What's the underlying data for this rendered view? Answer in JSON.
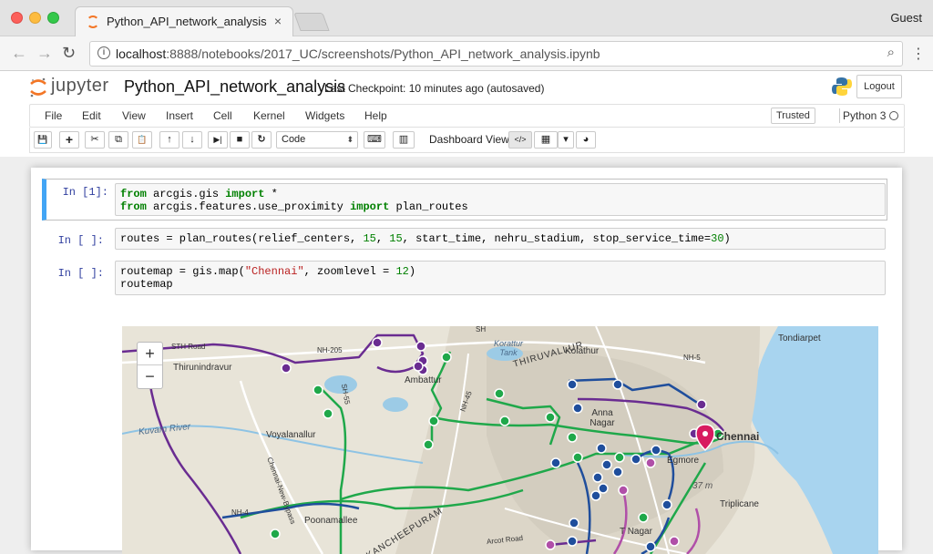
{
  "browser": {
    "tab_title": "Python_API_network_analysis",
    "tab_close": "×",
    "user": "Guest",
    "url_host": "localhost",
    "url_rest": ":8888/notebooks/2017_UC/screenshots/Python_API_network_analysis.ipynb",
    "back_icon": "←",
    "forward_icon": "→",
    "reload_icon": "↻",
    "zoom_icon": "⌕",
    "menu_icon": "⋮",
    "info_icon": "i"
  },
  "jupyter": {
    "logo_text": "jupyter",
    "notebook_name": "Python_API_network_analysis",
    "checkpoint": "Last Checkpoint: 10 minutes ago (autosaved)",
    "logout_label": "Logout",
    "menu": [
      "File",
      "Edit",
      "View",
      "Insert",
      "Cell",
      "Kernel",
      "Widgets",
      "Help"
    ],
    "trusted_label": "Trusted",
    "kernel_name": "Python 3",
    "cell_type": "Code",
    "dashboard_label": "Dashboard View:",
    "toolbar_icons": {
      "save": "💾",
      "add": "+",
      "cut": "✂",
      "copy": "⧉",
      "paste": "📋",
      "move_up": "↑",
      "move_down": "↓",
      "run": "▶|",
      "stop": "■",
      "restart": "↻",
      "keyboard": "⌨",
      "chart": "▥",
      "code_view": "</>",
      "grid_view": "▦",
      "dropdown": "▾",
      "gauge": "◕",
      "select_arrow": "⬍"
    }
  },
  "cells": [
    {
      "prompt": "In [1]:",
      "lines": [
        [
          {
            "t": "from",
            "k": "kw"
          },
          {
            "t": " arcgis.gis ",
            "k": ""
          },
          {
            "t": "import",
            "k": "kw"
          },
          {
            "t": " *",
            "k": ""
          }
        ],
        [
          {
            "t": "from",
            "k": "kw"
          },
          {
            "t": " arcgis.features.use_proximity ",
            "k": ""
          },
          {
            "t": "import",
            "k": "kw"
          },
          {
            "t": " plan_routes",
            "k": ""
          }
        ]
      ]
    },
    {
      "prompt": "In [ ]:",
      "lines": [
        [
          {
            "t": "routes = plan_routes(relief_centers, ",
            "k": ""
          },
          {
            "t": "15",
            "k": "num"
          },
          {
            "t": ", ",
            "k": ""
          },
          {
            "t": "15",
            "k": "num"
          },
          {
            "t": ", start_time, nehru_stadium, stop_service_time=",
            "k": ""
          },
          {
            "t": "30",
            "k": "num"
          },
          {
            "t": ")",
            "k": ""
          }
        ]
      ]
    },
    {
      "prompt": "In [ ]:",
      "lines": [
        [
          {
            "t": "routemap = gis.map(",
            "k": ""
          },
          {
            "t": "\"Chennai\"",
            "k": "str"
          },
          {
            "t": ", zoomlevel = ",
            "k": ""
          },
          {
            "t": "12",
            "k": "num"
          },
          {
            "t": ")",
            "k": ""
          }
        ],
        [
          {
            "t": "routemap",
            "k": ""
          }
        ]
      ]
    }
  ],
  "map": {
    "zoom_in": "+",
    "zoom_out": "−",
    "labels": {
      "tondiarpet": "Tondiarpet",
      "kolathur": "Kolathur",
      "thirunindravur": "Thirunindravur",
      "ambattur": "Ambattur",
      "korattur_tank": "Korattur Tank",
      "thiruvallur": "THIRUVALLUR",
      "voyalanallur": "Voyalanallur",
      "kuvam_river": "Kuvam River",
      "anna_nagar": "Anna Nagar",
      "chennai": "Chennai",
      "egmore": "Egmore",
      "triplicane": "Triplicane",
      "poonamallee": "Poonamallee",
      "kancheepuram": "KANCHEEPURAM",
      "nh205": "NH-205",
      "nh5": "NH-5",
      "nh4": "NH-4",
      "sh": "SH",
      "sh55": "SH-55",
      "nh45": "NH-45",
      "chennai_bypass": "Chennai-New-Bypass",
      "arcot_road": "Arcot Road",
      "t_nagar": "T Nagar",
      "elevation": "37 m",
      "sth_road": "STH Road"
    },
    "route_colors": {
      "purple": "#6a2c91",
      "green": "#1fa84a",
      "blue": "#1f4e9c",
      "magenta": "#b04fa8",
      "stop_marker": "#d81b60"
    }
  }
}
